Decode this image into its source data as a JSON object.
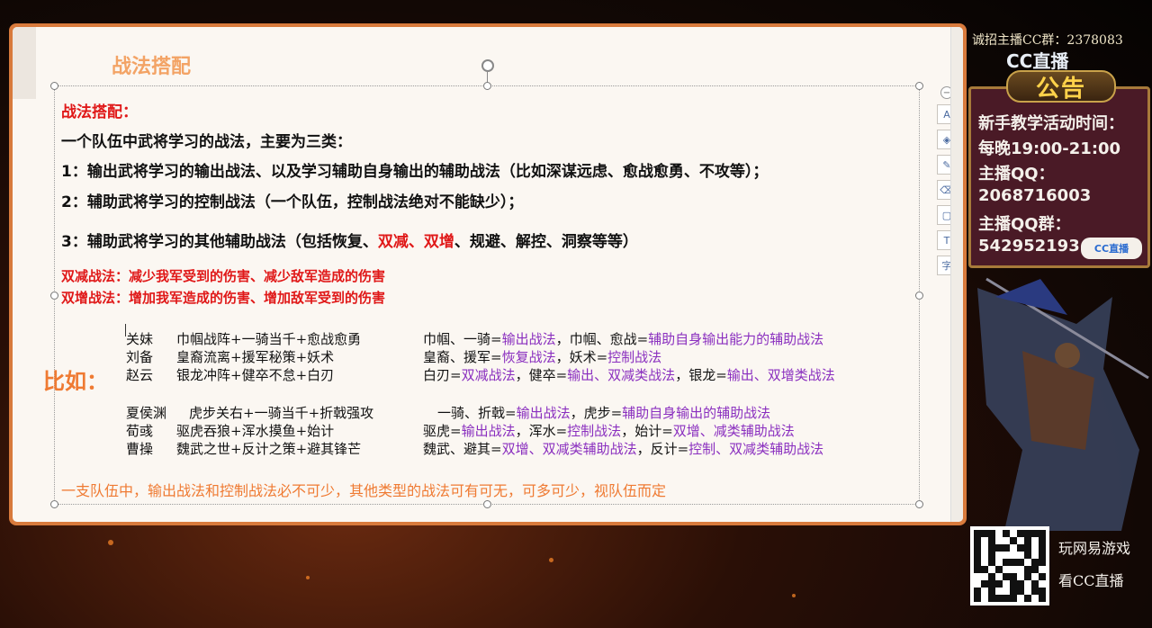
{
  "slide": {
    "header_title": "战法搭配",
    "section_title": "战法搭配：",
    "intro": "一个队伍中武将学习的战法，主要为三类：",
    "point1": "1：输出武将学习的输出战法、以及学习辅助自身输出的辅助战法（比如深谋远虑、愈战愈勇、不攻等）；",
    "point2": "2：辅助武将学习的控制战法（一个队伍，控制战法绝对不能缺少）；",
    "point3_a": "3：辅助武将学习的其他辅助战法（包括恢复、",
    "point3_b": "双减、双增",
    "point3_c": "、规避、解控、洞察等等）",
    "def_reduce": "双减战法：减少我军受到的伤害、减少敌军造成的伤害",
    "def_increase": "双增战法：增加我军造成的伤害、增加敌军受到的伤害",
    "example_label": "比如：",
    "examples": [
      {
        "general": "关妹",
        "skills": "巾帼战阵+一骑当千+愈战愈勇",
        "note_parts": [
          [
            "巾帼、一骑=",
            "k"
          ],
          [
            "输出战法",
            "p"
          ],
          [
            "，巾帼、愈战=",
            "k"
          ],
          [
            "辅助自身输出能力的辅助战法",
            "p"
          ]
        ]
      },
      {
        "general": "刘备",
        "skills": "皇裔流离+援军秘策+妖术",
        "note_parts": [
          [
            "皇裔、援军=",
            "k"
          ],
          [
            "恢复战法",
            "p"
          ],
          [
            "，妖术=",
            "k"
          ],
          [
            "控制战法",
            "p"
          ]
        ]
      },
      {
        "general": "赵云",
        "skills": "银龙冲阵+健卒不怠+白刃",
        "note_parts": [
          [
            "白刃=",
            "k"
          ],
          [
            "双减战法",
            "p"
          ],
          [
            "，健卒=",
            "k"
          ],
          [
            "输出、双减类战法",
            "p"
          ],
          [
            "，银龙=",
            "k"
          ],
          [
            "输出、双增类战法",
            "p"
          ]
        ]
      },
      {
        "general": "夏侯渊",
        "skills": "虎步关右+一骑当千+折戟强攻",
        "note_parts": [
          [
            "一骑、折戟=",
            "k"
          ],
          [
            "输出战法",
            "p"
          ],
          [
            "，虎步=",
            "k"
          ],
          [
            "辅助自身输出的辅助战法",
            "p"
          ]
        ]
      },
      {
        "general": "荀彧",
        "skills": "驱虎吞狼+浑水摸鱼+始计",
        "note_parts": [
          [
            "驱虎=",
            "k"
          ],
          [
            "输出战法",
            "p"
          ],
          [
            "，浑水=",
            "k"
          ],
          [
            "控制战法",
            "p"
          ],
          [
            "，始计=",
            "k"
          ],
          [
            "双增、减类辅助战法",
            "p"
          ]
        ]
      },
      {
        "general": "曹操",
        "skills": "魏武之世+反计之策+避其锋芒",
        "note_parts": [
          [
            "魏武、避其=",
            "k"
          ],
          [
            "双增、双减类辅助战法",
            "p"
          ],
          [
            "，反计=",
            "k"
          ],
          [
            "控制、双减类辅助战法",
            "p"
          ]
        ]
      }
    ],
    "conclusion": "一支队伍中，输出战法和控制战法必不可少，其他类型的战法可有可无，可多可少，视队伍而定"
  },
  "toolbar": [
    {
      "icon": "minus-icon",
      "glyph": "−"
    },
    {
      "icon": "text-format-icon",
      "glyph": "A"
    },
    {
      "icon": "layers-icon",
      "glyph": "◈"
    },
    {
      "icon": "pen-icon",
      "glyph": "✎"
    },
    {
      "icon": "eraser-icon",
      "glyph": "⌫"
    },
    {
      "icon": "frame-icon",
      "glyph": "▢"
    },
    {
      "icon": "text-box-icon",
      "glyph": "T"
    },
    {
      "icon": "character-icon",
      "glyph": "字"
    }
  ],
  "sidebar": {
    "recruit": "诚招主播CC群：2378083",
    "cc_logo": "CC直播",
    "announce": "公告",
    "notice_lines": [
      "新手教学活动时间：",
      "每晚19:00-21:00",
      "主播QQ：",
      "2068716003",
      "主播QQ群：",
      "542952193"
    ],
    "cc_badge": "CC直播",
    "promo_line1": "玩网易游戏",
    "promo_line2": "看CC直播"
  },
  "colors": {
    "accent_orange": "#ef7a32",
    "red": "#e01818",
    "purple": "#8a2fbf",
    "frame": "#d87a3c"
  }
}
